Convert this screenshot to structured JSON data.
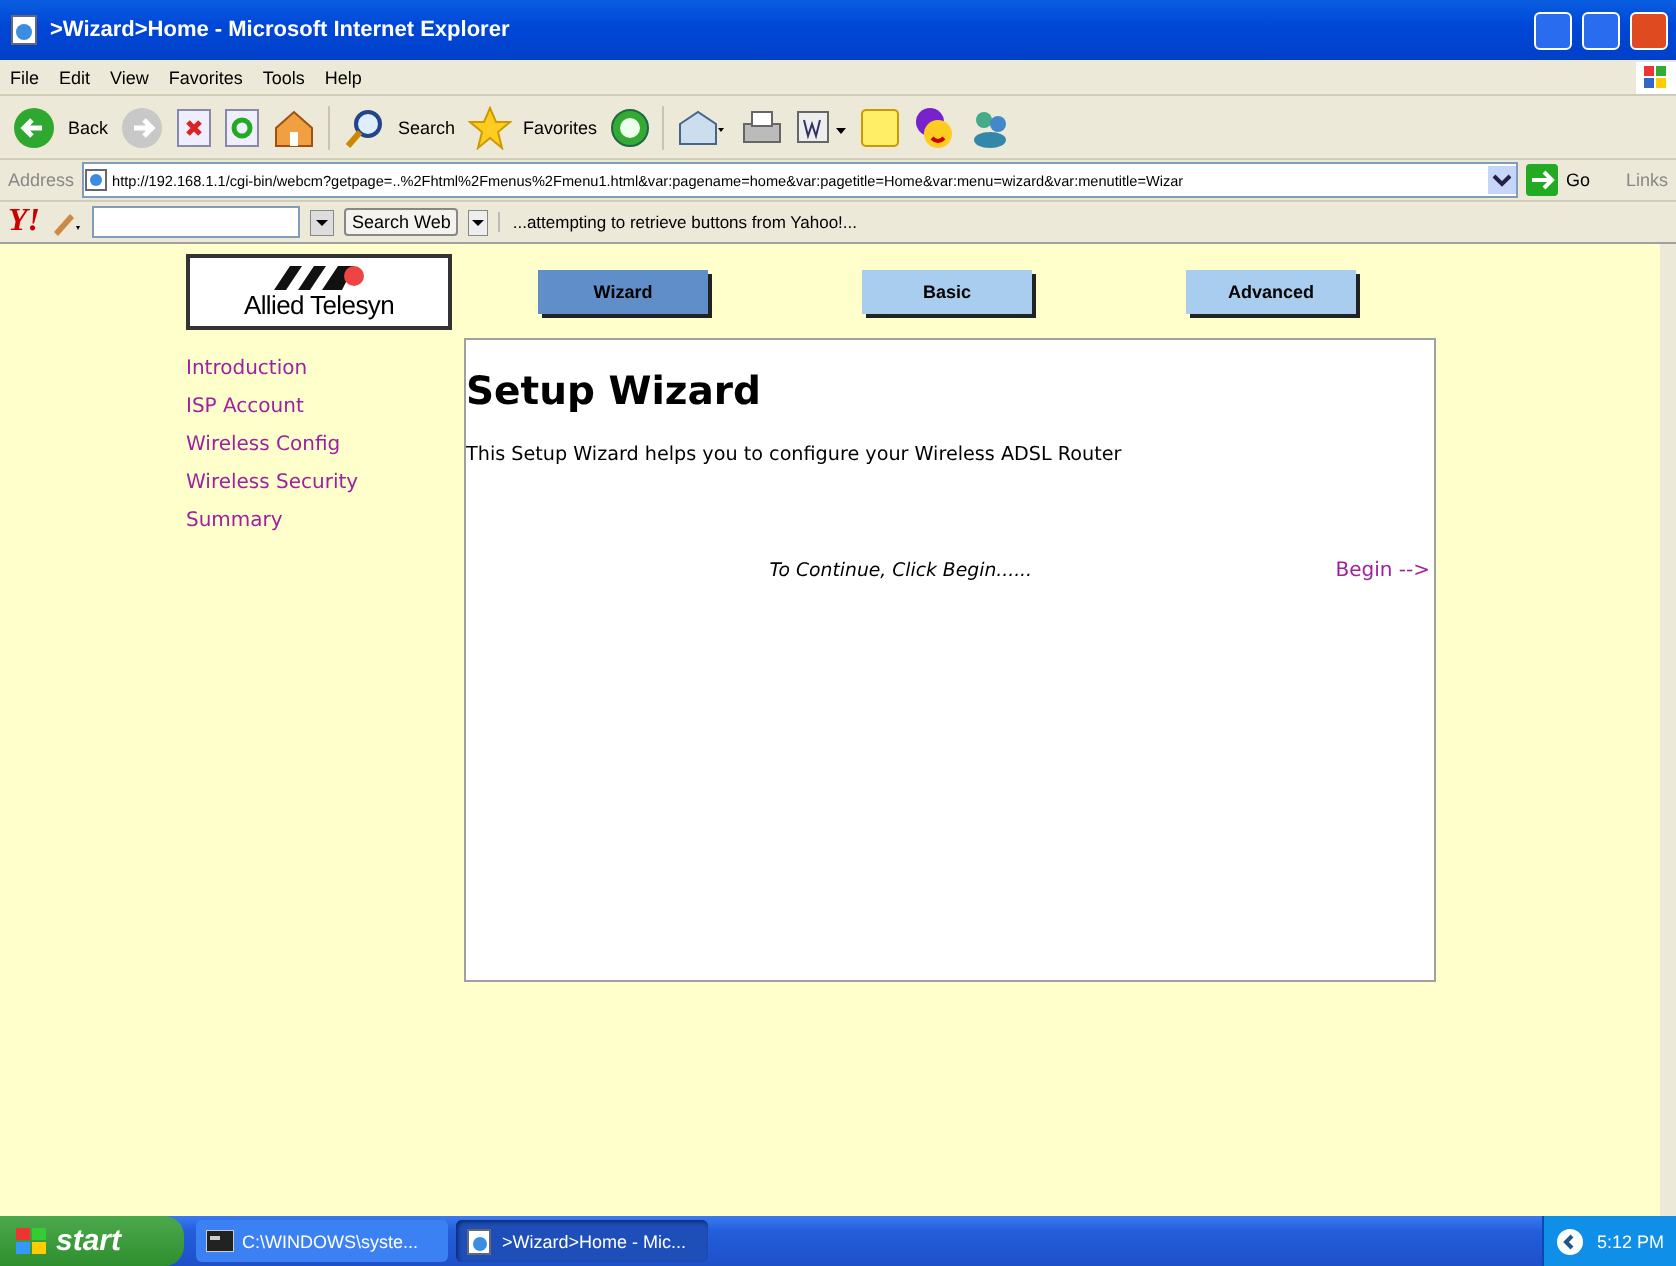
{
  "window": {
    "title": ">Wizard>Home - Microsoft Internet Explorer"
  },
  "menu": [
    "File",
    "Edit",
    "View",
    "Favorites",
    "Tools",
    "Help"
  ],
  "toolbar": {
    "back": "Back",
    "search": "Search",
    "favorites": "Favorites"
  },
  "address": {
    "label": "Address",
    "url": "http://192.168.1.1/cgi-bin/webcm?getpage=..%2Fhtml%2Fmenus%2Fmenu1.html&var:pagename=home&var:pagetitle=Home&var:menu=wizard&var:menutitle=Wizar",
    "go": "Go",
    "links": "Links"
  },
  "yahoo_bar": {
    "logo": "Y!",
    "search_button": "Search Web",
    "status": "...attempting to retrieve buttons from Yahoo!..."
  },
  "logo": {
    "text": "Allied Telesyn"
  },
  "tabs": [
    {
      "label": "Wizard",
      "selected": true
    },
    {
      "label": "Basic",
      "selected": false
    },
    {
      "label": "Advanced",
      "selected": false
    }
  ],
  "sidebar": {
    "items": [
      "Introduction",
      "ISP Account",
      "Wireless Config",
      "Wireless Security",
      "Summary"
    ]
  },
  "panel": {
    "title": "Setup Wizard",
    "description": "This Setup Wizard helps you to configure your Wireless ADSL Router",
    "prompt": "To Continue, Click Begin......",
    "next_link": "Begin -->"
  },
  "taskbar": {
    "start": "start",
    "tasks": [
      {
        "label": "C:\\WINDOWS\\syste...",
        "selected": false
      },
      {
        "label": ">Wizard>Home - Mic...",
        "selected": true
      }
    ],
    "clock": "5:12 PM"
  }
}
